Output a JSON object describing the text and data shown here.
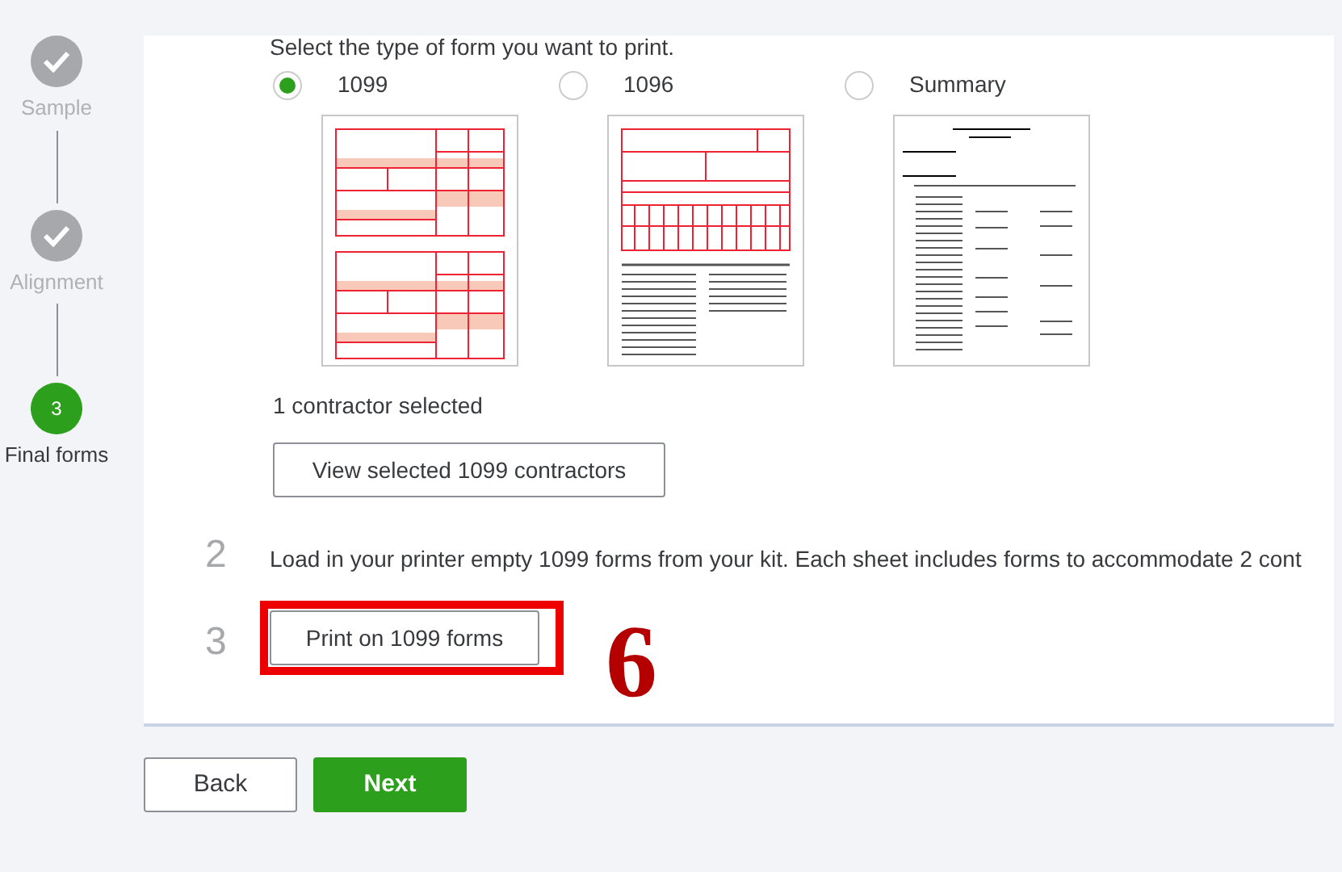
{
  "stepper": [
    {
      "label": "Sample",
      "completed": true
    },
    {
      "label": "Alignment",
      "completed": true
    },
    {
      "label": "Final forms",
      "completed": false,
      "number": "3"
    }
  ],
  "instructions": [
    {
      "text": "Select the type of form you want to print."
    },
    {
      "number": "2",
      "text": "Load in your printer empty 1099 forms from your kit. Each sheet includes forms to accommodate 2 cont"
    },
    {
      "number": "3"
    }
  ],
  "form_options": [
    {
      "label": "1099",
      "selected": true,
      "kind": "paired"
    },
    {
      "label": "1096",
      "selected": false,
      "kind": "transmittal"
    },
    {
      "label": "Summary",
      "selected": false,
      "kind": "summary"
    }
  ],
  "selection_note": "1 contractor selected",
  "view_button": "View selected 1099 contractors",
  "print_button": "Print on 1099 forms",
  "annotation": {
    "label": "6"
  },
  "footer_buttons": [
    {
      "label": "Back",
      "kind": "secondary"
    },
    {
      "label": "Next",
      "kind": "primary"
    }
  ]
}
